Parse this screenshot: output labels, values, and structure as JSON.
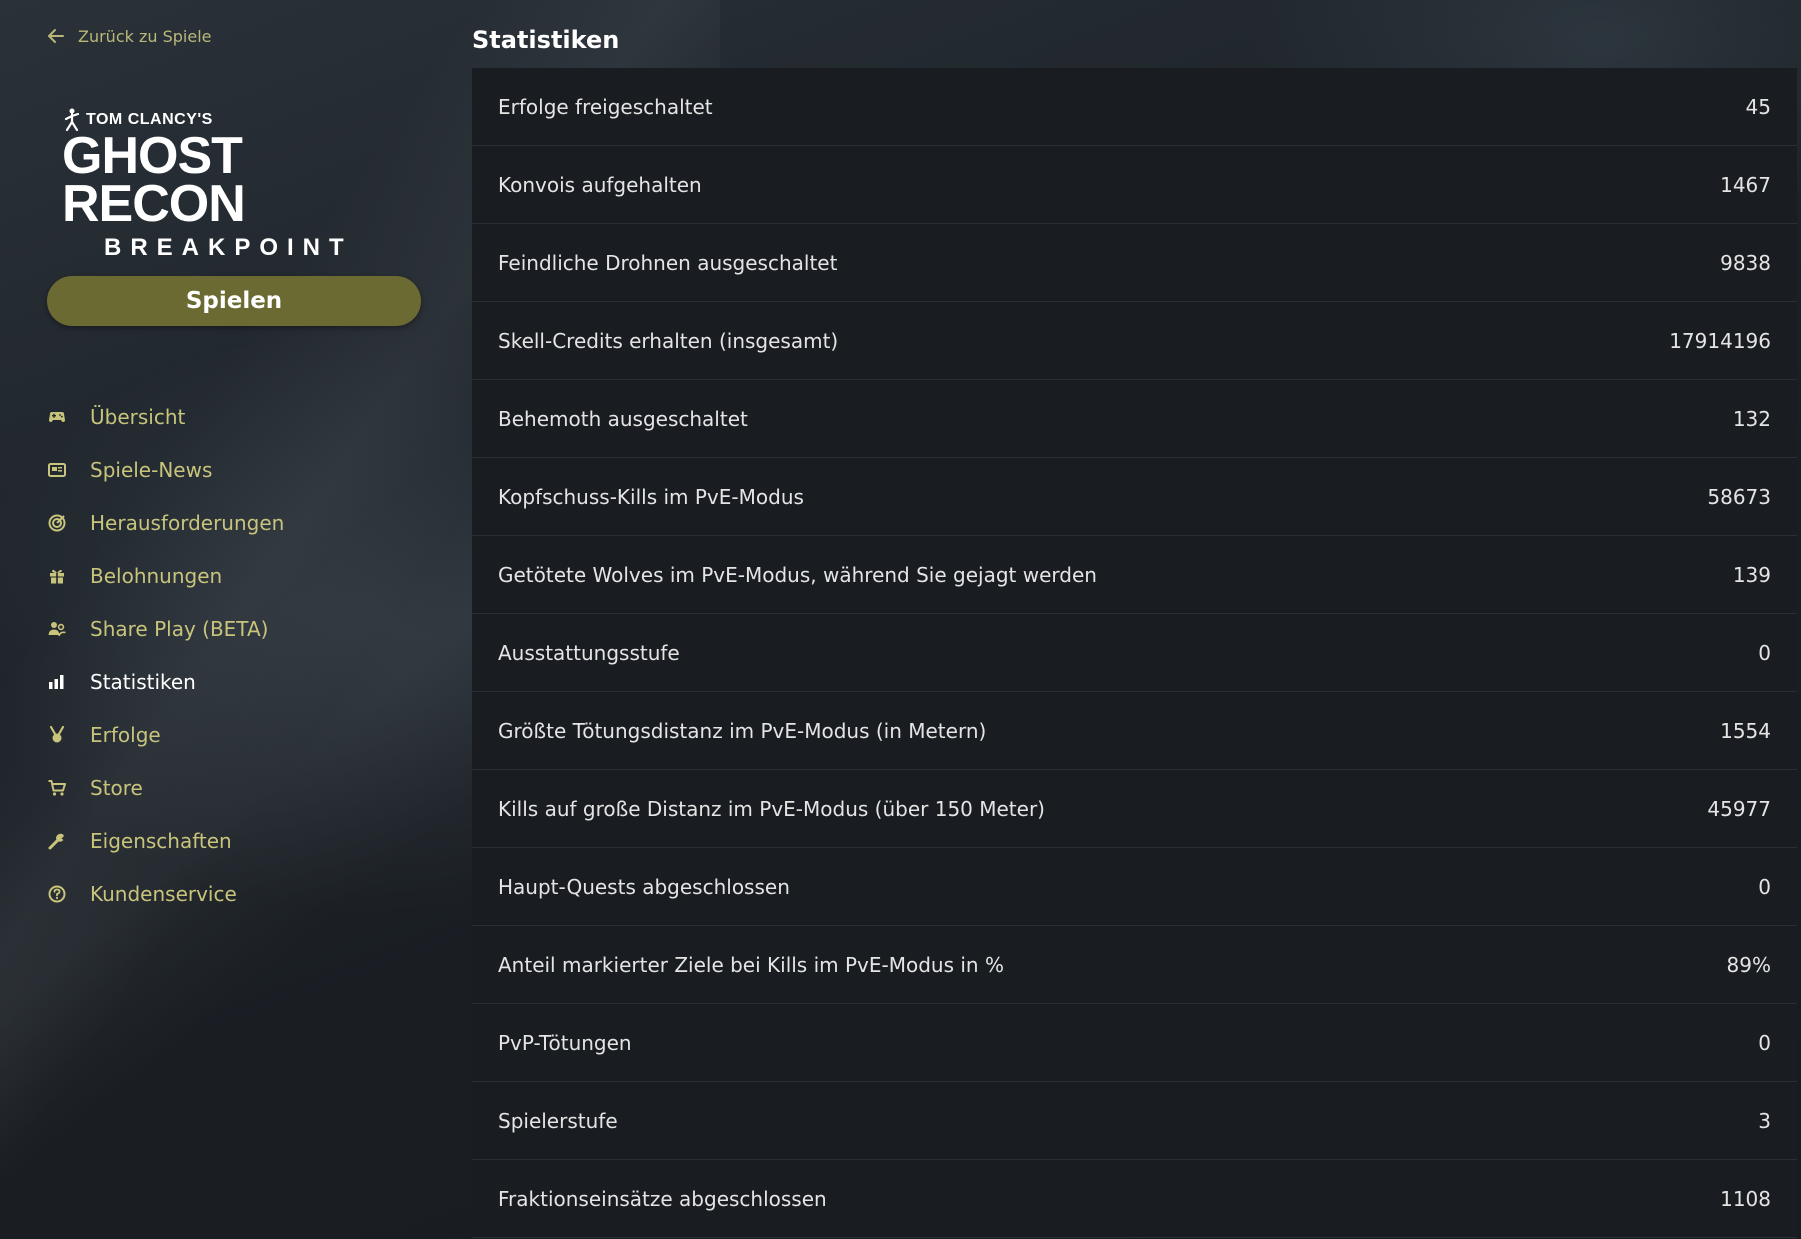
{
  "sidebar": {
    "back_label": "Zurück zu Spiele",
    "logo": {
      "top": "TOM CLANCY'S",
      "main": "GHOST RECON",
      "sub": "BREAKPOINT"
    },
    "play_label": "Spielen",
    "items": [
      {
        "label": "Übersicht",
        "icon": "gamepad-icon",
        "active": false
      },
      {
        "label": "Spiele-News",
        "icon": "newspaper-icon",
        "active": false
      },
      {
        "label": "Herausforderungen",
        "icon": "target-icon",
        "active": false
      },
      {
        "label": "Belohnungen",
        "icon": "gift-icon",
        "active": false
      },
      {
        "label": "Share Play (BETA)",
        "icon": "users-icon",
        "active": false
      },
      {
        "label": "Statistiken",
        "icon": "bar-chart-icon",
        "active": true
      },
      {
        "label": "Erfolge",
        "icon": "medal-icon",
        "active": false
      },
      {
        "label": "Store",
        "icon": "cart-icon",
        "active": false
      },
      {
        "label": "Eigenschaften",
        "icon": "wrench-icon",
        "active": false
      },
      {
        "label": "Kundenservice",
        "icon": "help-circle-icon",
        "active": false
      }
    ]
  },
  "main": {
    "title": "Statistiken",
    "stats": [
      {
        "label": "Erfolge freigeschaltet",
        "value": "45"
      },
      {
        "label": "Konvois aufgehalten",
        "value": "1467"
      },
      {
        "label": "Feindliche Drohnen ausgeschaltet",
        "value": "9838"
      },
      {
        "label": "Skell-Credits erhalten (insgesamt)",
        "value": "17914196"
      },
      {
        "label": "Behemoth ausgeschaltet",
        "value": "132"
      },
      {
        "label": "Kopfschuss-Kills im PvE-Modus",
        "value": "58673"
      },
      {
        "label": "Getötete Wolves im PvE-Modus, während Sie gejagt werden",
        "value": "139"
      },
      {
        "label": "Ausstattungsstufe",
        "value": "0"
      },
      {
        "label": "Größte Tötungsdistanz im PvE-Modus (in Metern)",
        "value": "1554"
      },
      {
        "label": "Kills auf große Distanz im PvE-Modus (über 150 Meter)",
        "value": "45977"
      },
      {
        "label": "Haupt-Quests abgeschlossen",
        "value": "0"
      },
      {
        "label": "Anteil markierter Ziele bei Kills im PvE-Modus in %",
        "value": "89%"
      },
      {
        "label": "PvP-Tötungen",
        "value": "0"
      },
      {
        "label": "Spielerstufe",
        "value": "3"
      },
      {
        "label": "Fraktionseinsätze abgeschlossen",
        "value": "1108"
      }
    ]
  },
  "colors": {
    "accent": "#c8c47c",
    "play_button": "#6b6a33",
    "row_bg": "#191c21",
    "background": "#1e242a"
  }
}
